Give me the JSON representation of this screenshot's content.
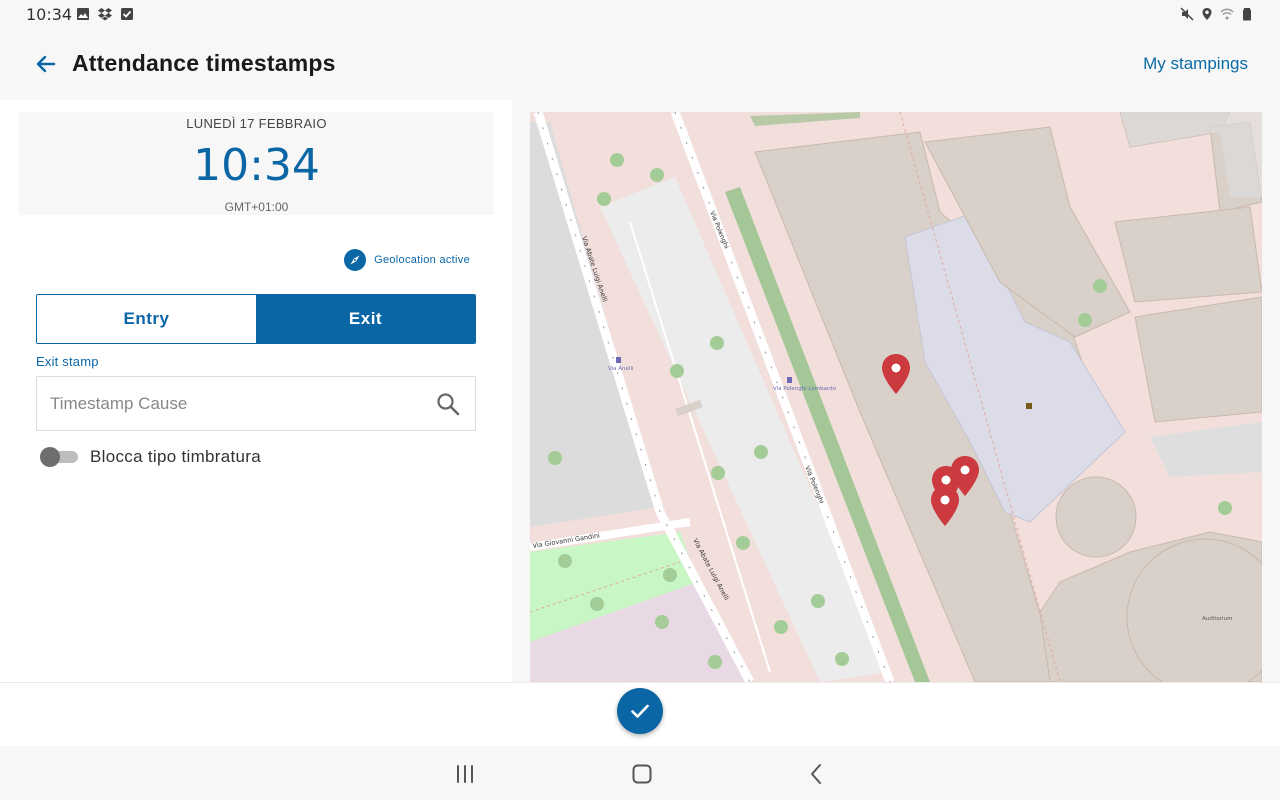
{
  "status_bar": {
    "time": "10:34",
    "icons_left": [
      "gallery-icon",
      "dropbox-icon",
      "checkbox-icon"
    ],
    "icons_right": [
      "mute-icon",
      "location-icon",
      "wifi-icon",
      "battery-icon"
    ]
  },
  "header": {
    "title": "Attendance timestamps",
    "my_stampings": "My stampings"
  },
  "clock": {
    "date": "LUNEDÌ 17 FEBBRAIO",
    "time": "10:34",
    "timezone": "GMT+01:00"
  },
  "geolocation": {
    "label": "Geolocation active"
  },
  "stamp_type": {
    "entry_label": "Entry",
    "exit_label": "Exit",
    "selected": "Exit"
  },
  "cause_field": {
    "caption": "Exit stamp",
    "value": "",
    "placeholder": "Timestamp Cause"
  },
  "lock_toggle": {
    "label": "Blocca tipo timbratura",
    "on": false
  },
  "map": {
    "street_labels": [
      "Via Abate Luigi Anelli",
      "Via Polenghi",
      "Via Giovanni Gandini",
      "Via Abate Luigi Anelli",
      "Via Polenghi"
    ],
    "stop_labels": [
      "Via Anelli",
      "Via Polenghi Lombardo"
    ],
    "place_labels": [
      "Auditorium"
    ],
    "marker_color": "#cc3a3f"
  },
  "colors": {
    "accent": "#0b66a6"
  }
}
